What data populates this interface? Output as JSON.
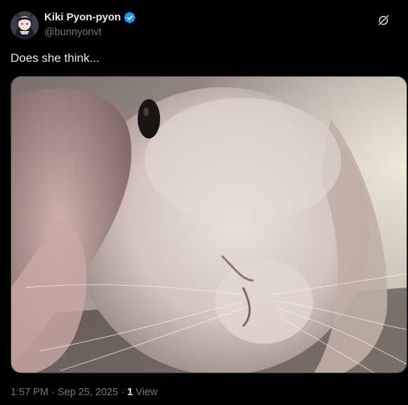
{
  "author": {
    "display_name": "Kiki Pyon-pyon",
    "handle": "@bunnyonvt",
    "verified": true
  },
  "tweet": {
    "text": "Does she think..."
  },
  "media": {
    "kind": "photo",
    "subject": "bunny"
  },
  "meta": {
    "time": "1:57 PM",
    "separator": " · ",
    "date": "Sep 25, 2025",
    "views_count": "1",
    "views_label": " View"
  },
  "icons": {
    "verified": "verified-badge-icon",
    "grok": "grok-icon"
  },
  "colors": {
    "background": "#000000",
    "primary_text": "#e7e9ea",
    "secondary_text": "#71767b",
    "verified_blue": "#1d9bf0",
    "border": "#2f3336"
  }
}
